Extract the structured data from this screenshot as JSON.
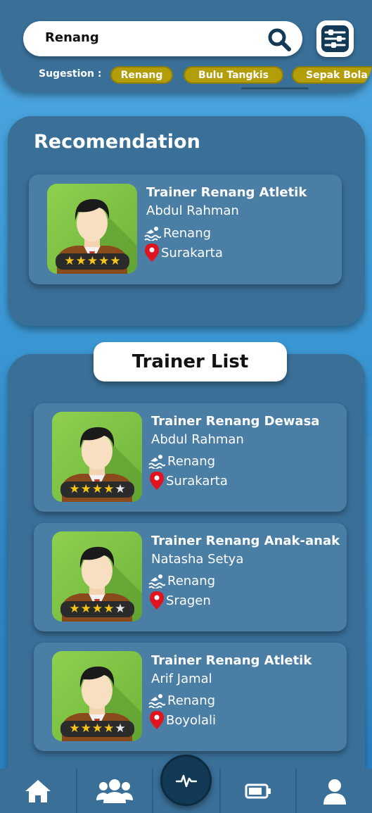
{
  "search": {
    "value": "Renang"
  },
  "suggestions": {
    "label": "Sugestion :",
    "items": [
      "Renang",
      "Bulu Tangkis",
      "Sepak Bola"
    ]
  },
  "recommendation": {
    "title": "Recomendation",
    "card": {
      "title": "Trainer Renang Atletik",
      "name": "Abdul Rahman",
      "sport": "Renang",
      "location": "Surakarta",
      "rating": 5
    }
  },
  "trainer_list": {
    "title": "Trainer List",
    "items": [
      {
        "title": "Trainer Renang Dewasa",
        "name": "Abdul Rahman",
        "sport": "Renang",
        "location": "Surakarta",
        "rating": 4
      },
      {
        "title": "Trainer Renang Anak-anak",
        "name": "Natasha Setya",
        "sport": "Renang",
        "location": "Sragen",
        "rating": 4
      },
      {
        "title": "Trainer Renang Atletik",
        "name": "Arif Jamal",
        "sport": "Renang",
        "location": "Boyolali",
        "rating": 4
      }
    ]
  },
  "bottom_nav": {
    "items": [
      "home-icon",
      "group-icon",
      "activity-icon",
      "battery-icon",
      "profile-icon"
    ]
  },
  "colors": {
    "panel": "#3a6f98",
    "card": "#4a7ea5",
    "chip": "#b39e0a",
    "star": "#f5c518",
    "location_pin": "#e0141e"
  }
}
